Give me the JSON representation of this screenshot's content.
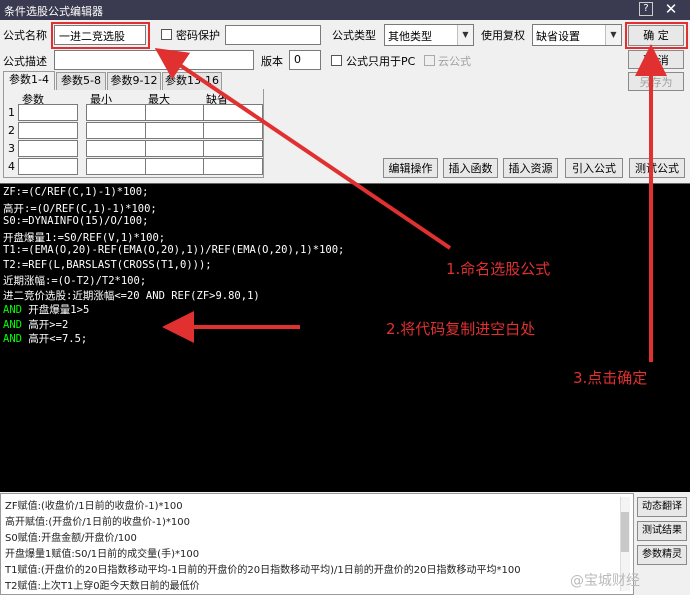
{
  "window": {
    "title": "条件选股公式编辑器",
    "help_glyph": "?",
    "close_glyph": "✕"
  },
  "form": {
    "name_label": "公式名称",
    "name_value": "一进二竞选股",
    "password_label": "密码保护",
    "password_value": "",
    "type_label": "公式类型",
    "type_value": "其他类型",
    "restore_label": "使用复权",
    "restore_value": "缺省设置",
    "desc_label": "公式描述",
    "desc_value": "",
    "version_label": "版本",
    "version_value": "0",
    "pc_only_label": "公式只用于PC",
    "cloud_label": "云公式"
  },
  "buttons": {
    "ok": "确  定",
    "cancel": "取  消",
    "save_as": "另存为",
    "edit_ops": "编辑操作",
    "insert_func": "插入函数",
    "insert_resource": "插入资源",
    "import_formula": "引入公式",
    "test_formula": "测试公式"
  },
  "param_tabs": [
    "参数1-4",
    "参数5-8",
    "参数9-12",
    "参数13-16"
  ],
  "param_headers": [
    "参数",
    "最小",
    "最大",
    "缺省"
  ],
  "param_rows": [
    "1",
    "2",
    "3",
    "4"
  ],
  "code_lines": [
    [
      {
        "t": "ZF:=(C/REF(C,1)-1)*100;",
        "c": "w"
      }
    ],
    [
      {
        "t": "高开:=(O/REF(C,1)-1)*100;",
        "c": "w"
      }
    ],
    [
      {
        "t": "S0:=DYNAINFO(15)/O/100;",
        "c": "w"
      }
    ],
    [
      {
        "t": "开盘爆量1:=S0/REF(V,1)*100;",
        "c": "w"
      }
    ],
    [
      {
        "t": "T1:=(EMA(O,20)-REF(EMA(O,20),1))/REF(EMA(O,20),1)*100;",
        "c": "w"
      }
    ],
    [
      {
        "t": "T2:=REF(L,BARSLAST(CROSS(T1,0)));",
        "c": "w"
      }
    ],
    [
      {
        "t": "近期涨幅:=(O-T2)/T2*100;",
        "c": "w"
      }
    ],
    [
      {
        "t": "进二竞价选股:近期涨幅<=20 AND REF(ZF>9.80,1)",
        "c": "w"
      }
    ],
    [
      {
        "t": "AND ",
        "c": "g"
      },
      {
        "t": "开盘爆量1>5",
        "c": "w"
      }
    ],
    [
      {
        "t": "AND ",
        "c": "g"
      },
      {
        "t": "高开>=2",
        "c": "w"
      }
    ],
    [
      {
        "t": "AND ",
        "c": "g"
      },
      {
        "t": "高开<=7.5;",
        "c": "w"
      }
    ]
  ],
  "bottom_lines": [
    "ZF赋值:(收盘价/1日前的收盘价-1)*100",
    "高开赋值:(开盘价/1日前的收盘价-1)*100",
    "S0赋值:开盘金额/开盘价/100",
    "开盘爆量1赋值:S0/1日前的成交量(手)*100",
    "T1赋值:(开盘价的20日指数移动平均-1日前的开盘价的20日指数移动平均)/1日前的开盘价的20日指数移动平均*100",
    "T2赋值:上次T1上穿0距今天数日前的最低价"
  ],
  "side_buttons": [
    "动态翻译",
    "测试结果",
    "参数精灵"
  ],
  "annotations": {
    "step1": "1.命名选股公式",
    "step2": "2.将代码复制进空白处",
    "step3": "3.点击确定",
    "color": "#e03030"
  },
  "watermark": "@宝城财经"
}
